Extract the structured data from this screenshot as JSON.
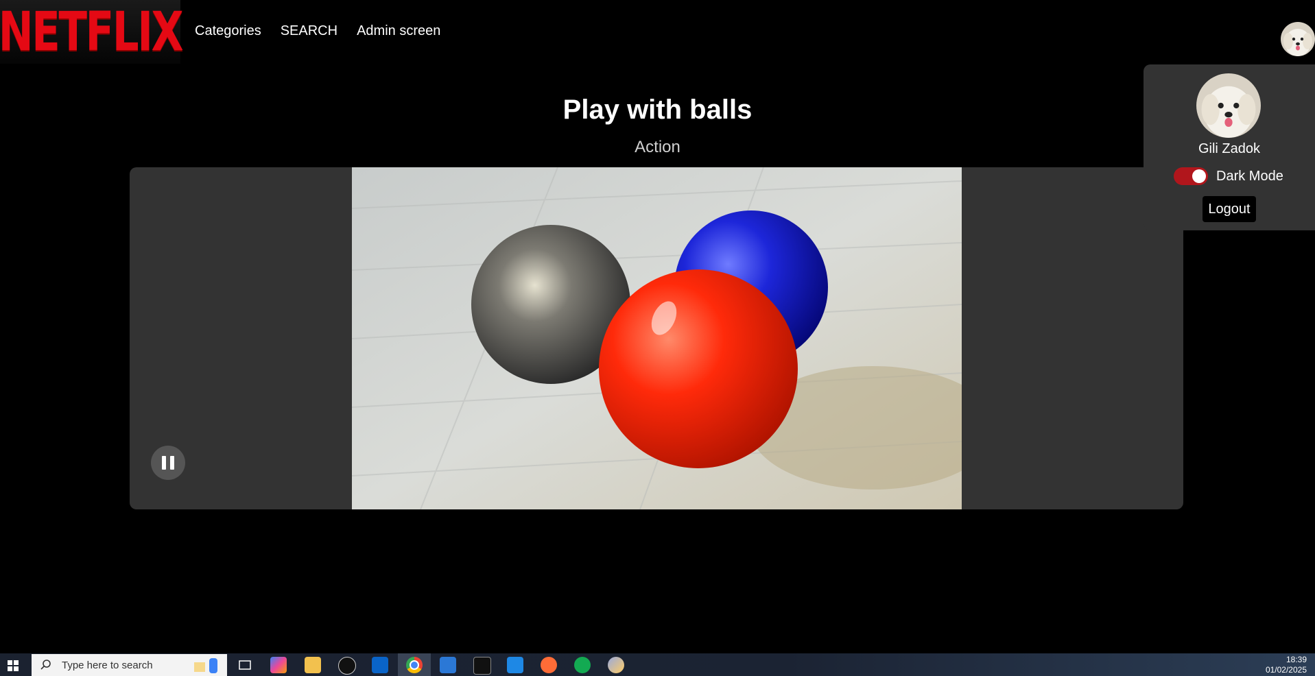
{
  "header": {
    "logo_text": "NETFLIX",
    "nav": [
      {
        "label": "Categories"
      },
      {
        "label": "SEARCH"
      },
      {
        "label": "Admin screen"
      }
    ]
  },
  "movie": {
    "title": "Play with balls",
    "genre": "Action"
  },
  "player": {
    "state": "playing",
    "control_icon": "pause-icon"
  },
  "profile_menu": {
    "username": "Gili Zadok",
    "dark_mode_label": "Dark Mode",
    "dark_mode_on": true,
    "logout_label": "Logout"
  },
  "taskbar": {
    "search_placeholder": "Type here to search",
    "time": "18:39",
    "date": "01/02/2025",
    "apps": [
      "task-view-icon",
      "copilot-icon",
      "file-explorer-icon",
      "dell-icon",
      "outlook-icon",
      "chrome-icon",
      "store-icon",
      "terminal-icon",
      "vscode-icon",
      "postman-icon",
      "mongodb-icon",
      "paint-icon"
    ]
  },
  "colors": {
    "brand": "#e50914",
    "toggle_on": "#b1161c",
    "panel": "#333333"
  }
}
